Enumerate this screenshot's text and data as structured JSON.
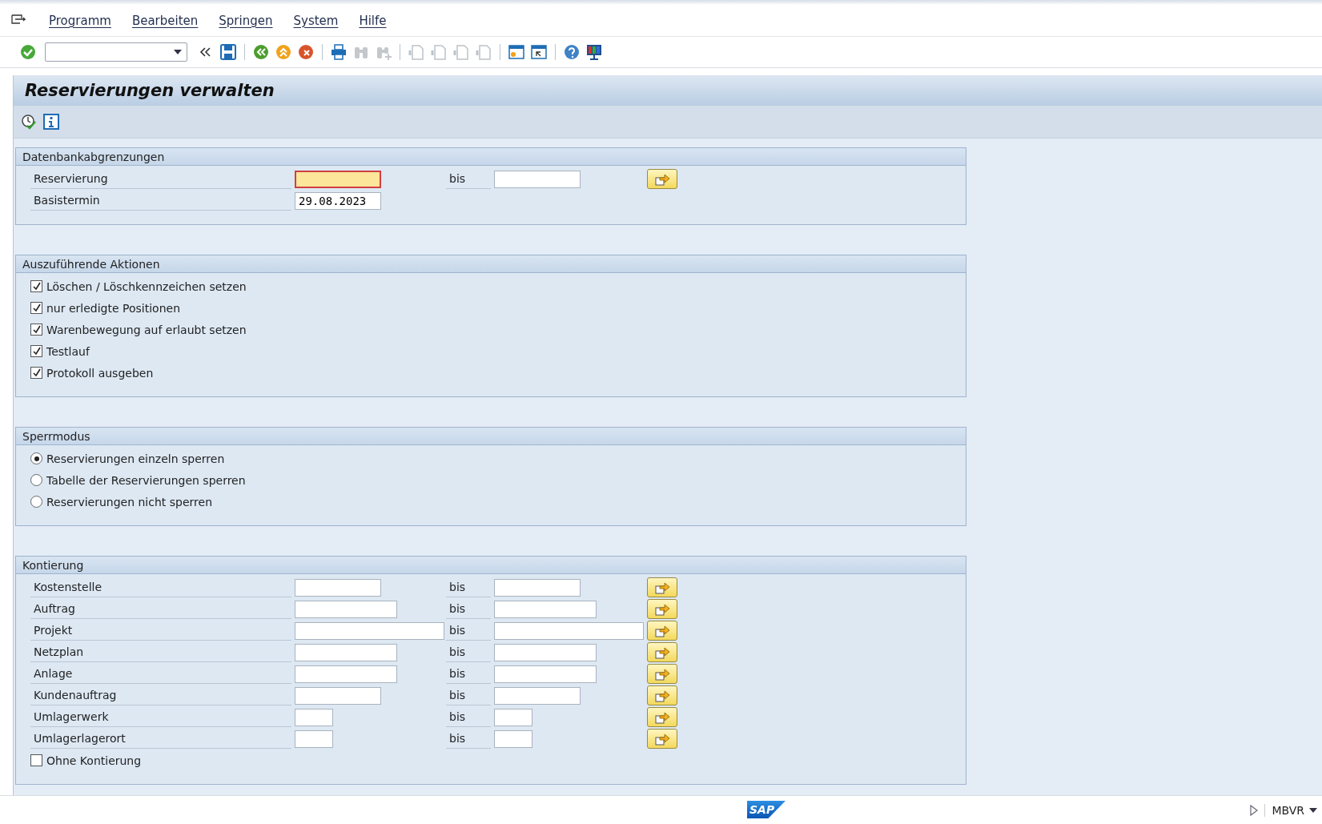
{
  "menu": [
    {
      "label": "Programm"
    },
    {
      "label": "Bearbeiten"
    },
    {
      "label": "Springen"
    },
    {
      "label": "System"
    },
    {
      "label": "Hilfe"
    }
  ],
  "title": "Reservierungen verwalten",
  "groups": [
    {
      "title": "Datenbankabgrenzungen",
      "items": [
        {
          "kind": "range",
          "label": "Reservierung",
          "to_label": "bis",
          "focused": true
        },
        {
          "kind": "single",
          "label": "Basistermin",
          "value": "29.08.2023",
          "focused": false
        }
      ]
    },
    {
      "title": "Auszuführende Aktionen",
      "items": [
        {
          "kind": "checkbox",
          "label": "Löschen / Löschkennzeichen setzen",
          "checked": true
        },
        {
          "kind": "checkbox",
          "label": "nur erledigte Positionen",
          "checked": true
        },
        {
          "kind": "checkbox",
          "label": "Warenbewegung auf erlaubt setzen",
          "checked": true
        },
        {
          "kind": "checkbox",
          "label": "Testlauf",
          "checked": true
        },
        {
          "kind": "checkbox",
          "label": "Protokoll ausgeben",
          "checked": true
        }
      ]
    },
    {
      "title": "Sperrmodus",
      "items": [
        {
          "kind": "radio",
          "label": "Reservierungen einzeln sperren",
          "selected": true
        },
        {
          "kind": "radio",
          "label": "Tabelle der Reservierungen sperren",
          "selected": false
        },
        {
          "kind": "radio",
          "label": "Reservierungen nicht sperren",
          "selected": false
        }
      ]
    },
    {
      "title": "Kontierung",
      "items": [
        {
          "kind": "range",
          "label": "Kostenstelle",
          "to_label": "bis",
          "focused": false
        },
        {
          "kind": "range",
          "label": "Auftrag",
          "to_label": "bis",
          "focused": false
        },
        {
          "kind": "range",
          "label": "Projekt",
          "to_label": "bis",
          "focused": false
        },
        {
          "kind": "range",
          "label": "Netzplan",
          "to_label": "bis",
          "focused": false
        },
        {
          "kind": "range",
          "label": "Anlage",
          "to_label": "bis",
          "focused": false
        },
        {
          "kind": "range",
          "label": "Kundenauftrag",
          "to_label": "bis",
          "focused": false
        },
        {
          "kind": "range",
          "label": "Umlagerwerk",
          "to_label": "bis",
          "focused": false
        },
        {
          "kind": "range",
          "label": "Umlagerlagerort",
          "to_label": "bis",
          "focused": false
        },
        {
          "kind": "checkbox",
          "label": "Ohne Kontierung",
          "checked": false
        }
      ]
    }
  ],
  "status_bar": {
    "logo": "SAP",
    "transaction": "MBVR"
  }
}
